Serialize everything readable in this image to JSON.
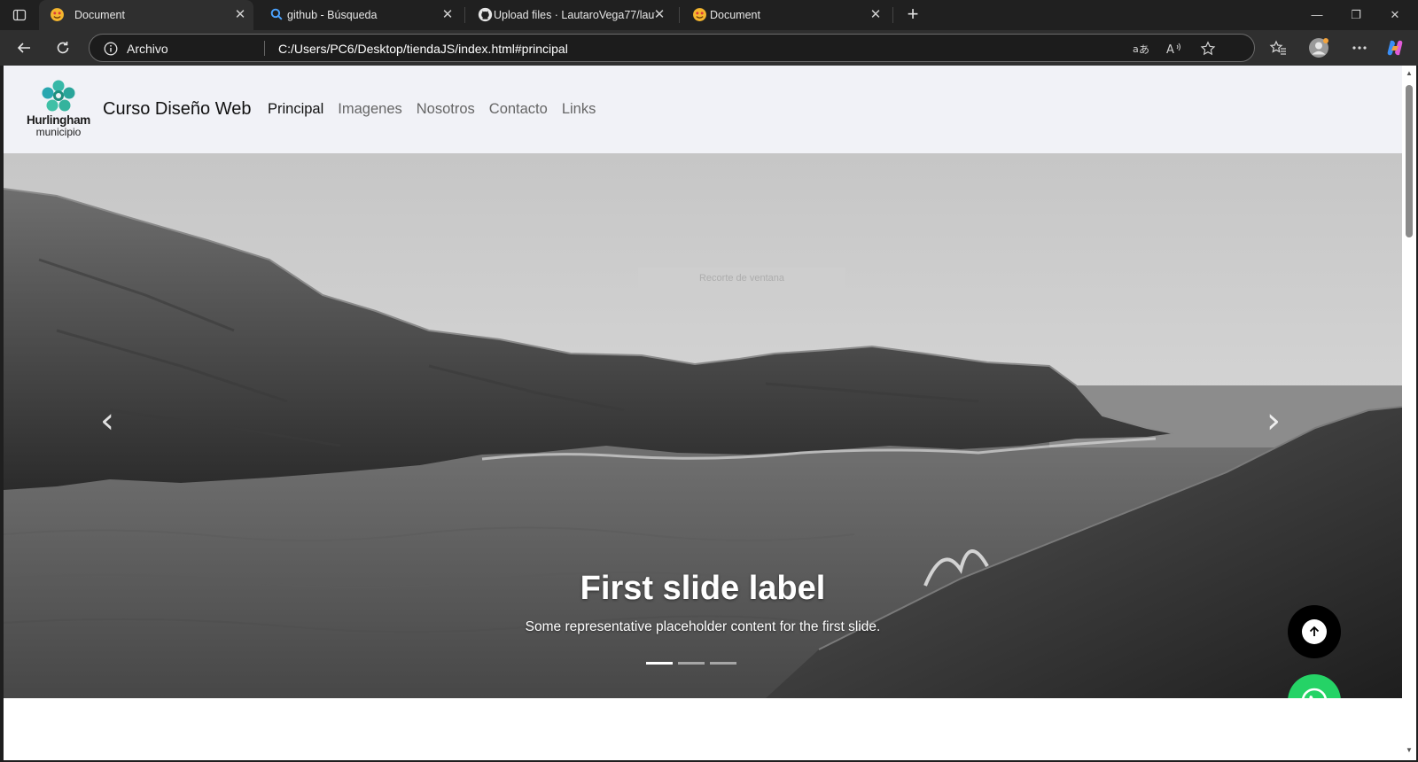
{
  "browser": {
    "tabs": [
      {
        "title": "Document",
        "favicon": "smiling-face-favicon",
        "active": true
      },
      {
        "title": "github - Búsqueda",
        "favicon": "search-favicon",
        "active": false
      },
      {
        "title": "Upload files · LautaroVega77/lautaro",
        "favicon": "github-favicon",
        "active": false
      },
      {
        "title": "Document",
        "favicon": "smiling-face-favicon",
        "active": false
      }
    ],
    "address": {
      "scheme_label": "Archivo",
      "url": "C:/Users/PC6/Desktop/tiendaJS/index.html#principal"
    },
    "omnibox_icons": [
      "translate-icon",
      "read-aloud-icon",
      "favorite-star-icon"
    ],
    "toolbar_icons": [
      "favorites-icon",
      "profile-avatar",
      "more-menu-icon",
      "copilot-icon"
    ]
  },
  "site": {
    "logo": {
      "line1": "Hurlingham",
      "line2": "municipio",
      "color": "#2ab5a5"
    },
    "brand": "Curso Diseño Web",
    "nav": [
      {
        "label": "Principal",
        "active": true
      },
      {
        "label": "Imagenes",
        "active": false
      },
      {
        "label": "Nosotros",
        "active": false
      },
      {
        "label": "Contacto",
        "active": false
      },
      {
        "label": "Links",
        "active": false
      }
    ],
    "carousel": {
      "tooltip": "Recorte de ventana",
      "caption_title": "First slide label",
      "caption_text": "Some representative placeholder content for the first slide.",
      "indicators": 3,
      "active_indicator": 0,
      "prev_glyph": "‹",
      "next_glyph": "›"
    },
    "floating": {
      "scroll_top_color": "#000000",
      "whatsapp_color": "#25d366"
    }
  }
}
